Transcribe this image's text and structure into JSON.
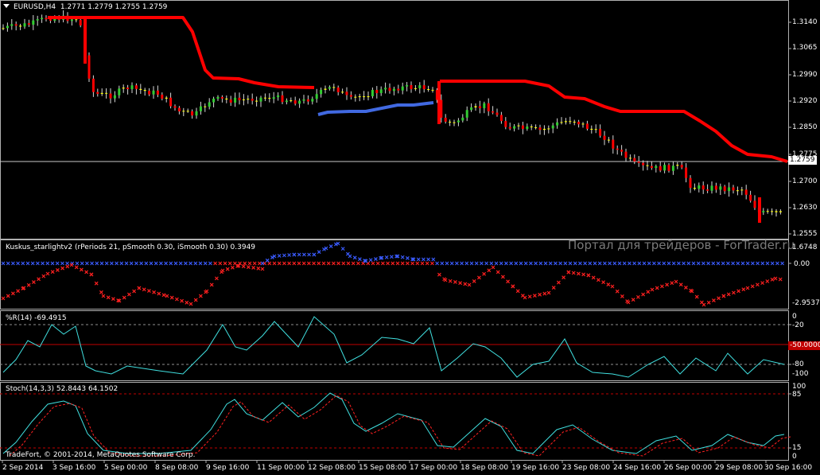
{
  "main": {
    "symbol": "EURUSD,H4",
    "ohlc": "1.2771 1.2779 1.2755 1.2759",
    "price_axis": [
      "1.3140",
      "1.3065",
      "1.2990",
      "1.2920",
      "1.2850",
      "1.2775",
      "1.2700",
      "1.2630",
      "1.2555"
    ],
    "current_price": "1.2759",
    "watermark": "Портал для трейдеров - ForTrader.ru"
  },
  "kuskus": {
    "title": "Kuskus_starlightv2  (rPeriods 21, pSmooth 0.30, iSmooth 0.30)  0.3949",
    "axis": [
      "1.6748",
      "0.00",
      "-2.9537"
    ]
  },
  "wpr": {
    "title": "%R(14) -69.4915",
    "axis": [
      "-20",
      "-80",
      "-100"
    ],
    "level_tag": "-50.0000",
    "axis_top": "0"
  },
  "stoch": {
    "title": "Stoch(14,3,3) 52.8443 64.1502",
    "axis": [
      "100",
      "85",
      "15",
      "0"
    ]
  },
  "footer": {
    "copyright": "TradeFort, © 2001-2014, MetaQuotes Software Corp."
  },
  "time_axis": [
    "2 Sep 2014",
    "3 Sep 16:00",
    "5 Sep 00:00",
    "8 Sep 08:00",
    "9 Sep 16:00",
    "11 Sep 00:00",
    "12 Sep 08:00",
    "15 Sep 08:00",
    "17 Sep 00:00",
    "18 Sep 08:00",
    "19 Sep 16:00",
    "23 Sep 08:00",
    "24 Sep 16:00",
    "26 Sep 00:00",
    "29 Sep 08:00",
    "30 Sep 16:00"
  ],
  "colors": {
    "bull": "#32cd32",
    "bear": "#ff0000",
    "wick": "#d8d8d8",
    "doji": "#ffff00",
    "trail_red": "#ff0000",
    "trail_blue": "#4169e1",
    "kk_blue": "#3a5bff",
    "kk_red": "#ff2020",
    "osc_line": "#40e0e0",
    "signal": "#ff2020",
    "level": "#c00000"
  }
}
